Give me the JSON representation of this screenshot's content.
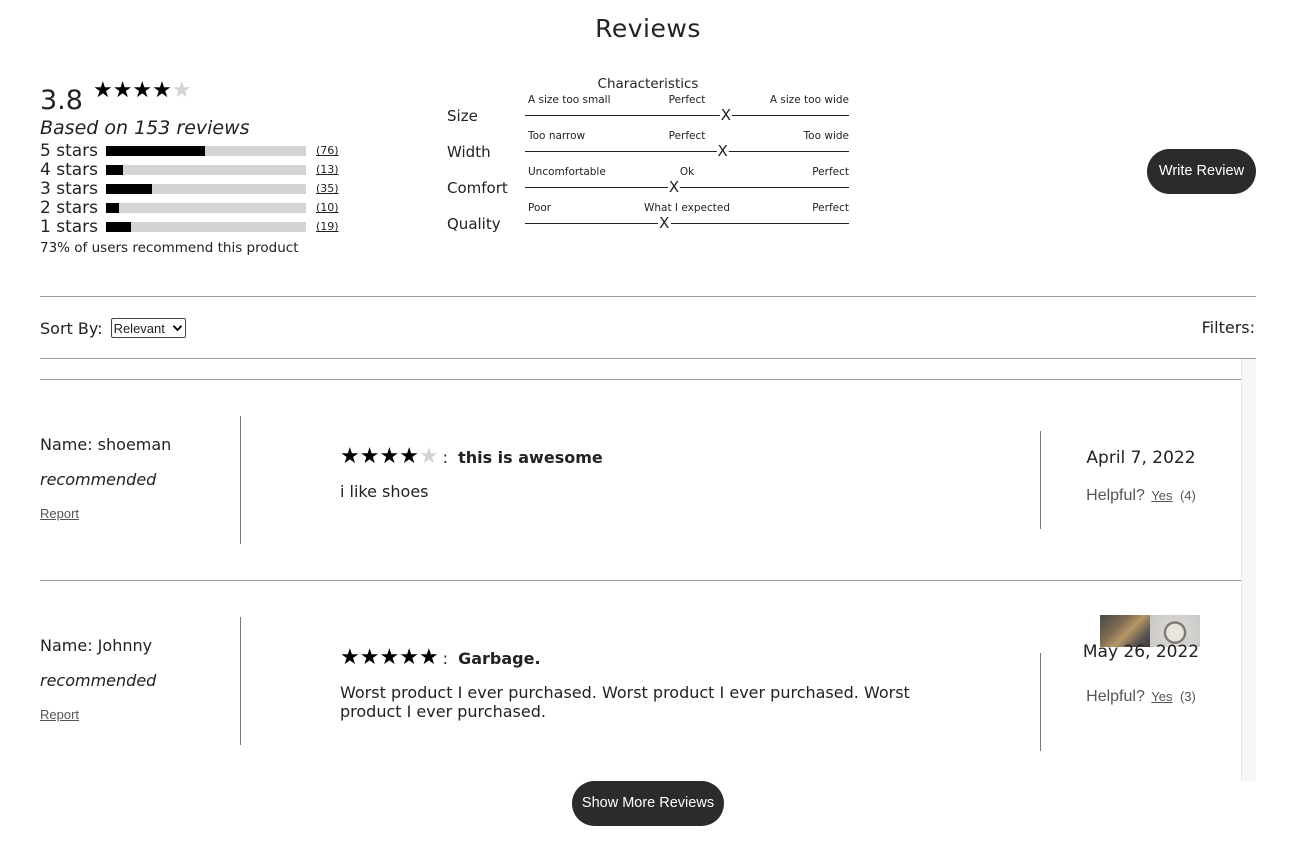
{
  "title": "Reviews",
  "summary": {
    "average": "3.8",
    "average_stars": 3.8,
    "based_on": "Based on 153 reviews",
    "breakdown": [
      {
        "label": "5 stars",
        "count": "(76)",
        "value": 76
      },
      {
        "label": "4 stars",
        "count": "(13)",
        "value": 13
      },
      {
        "label": "3 stars",
        "count": "(35)",
        "value": 35
      },
      {
        "label": "2 stars",
        "count": "(10)",
        "value": 10
      },
      {
        "label": "1 stars",
        "count": "(19)",
        "value": 19
      }
    ],
    "recommend": "73% of users recommend this product"
  },
  "characteristics": {
    "title": "Characteristics",
    "items": [
      {
        "name": "Size",
        "low": "A size too small",
        "mid": "Perfect",
        "high": "A size too wide",
        "position": 0.62
      },
      {
        "name": "Width",
        "low": "Too narrow",
        "mid": "Perfect",
        "high": "Too wide",
        "position": 0.61
      },
      {
        "name": "Comfort",
        "low": "Uncomfortable",
        "mid": "Ok",
        "high": "Perfect",
        "position": 0.46
      },
      {
        "name": "Quality",
        "low": "Poor",
        "mid": "What I expected",
        "high": "Perfect",
        "position": 0.43
      }
    ]
  },
  "buttons": {
    "write_review": "Write Review",
    "show_more": "Show More Reviews"
  },
  "toolbar": {
    "sort_label": "Sort By:",
    "sort_value": "Relevant",
    "filters_label": "Filters:"
  },
  "reviews": [
    {
      "name": "Name: shoeman",
      "recommended": "recommended",
      "report": "Report",
      "rating": 4,
      "colon": ":",
      "summary": "this is awesome",
      "body": "i like shoes",
      "date": "April 7, 2022",
      "helpful": "Helpful?",
      "yes": "Yes",
      "count": "(4)"
    },
    {
      "name": "Name: Johnny",
      "recommended": "recommended",
      "report": "Report",
      "rating": 5,
      "colon": ":",
      "summary": "Garbage.",
      "body": "Worst product I ever purchased. Worst product I ever purchased. Worst product I ever purchased.",
      "date": "May 26, 2022",
      "helpful": "Helpful?",
      "yes": "Yes",
      "count": "(3)"
    }
  ],
  "icons": {
    "star_filled": "★",
    "star_empty": "★",
    "dropdown": "chevron-down-icon"
  },
  "colors": {
    "button_bg": "#2b2b2b",
    "bar_fill": "#000000",
    "bar_track": "#d4d4d4",
    "empty_star": "#d3d3d3"
  }
}
